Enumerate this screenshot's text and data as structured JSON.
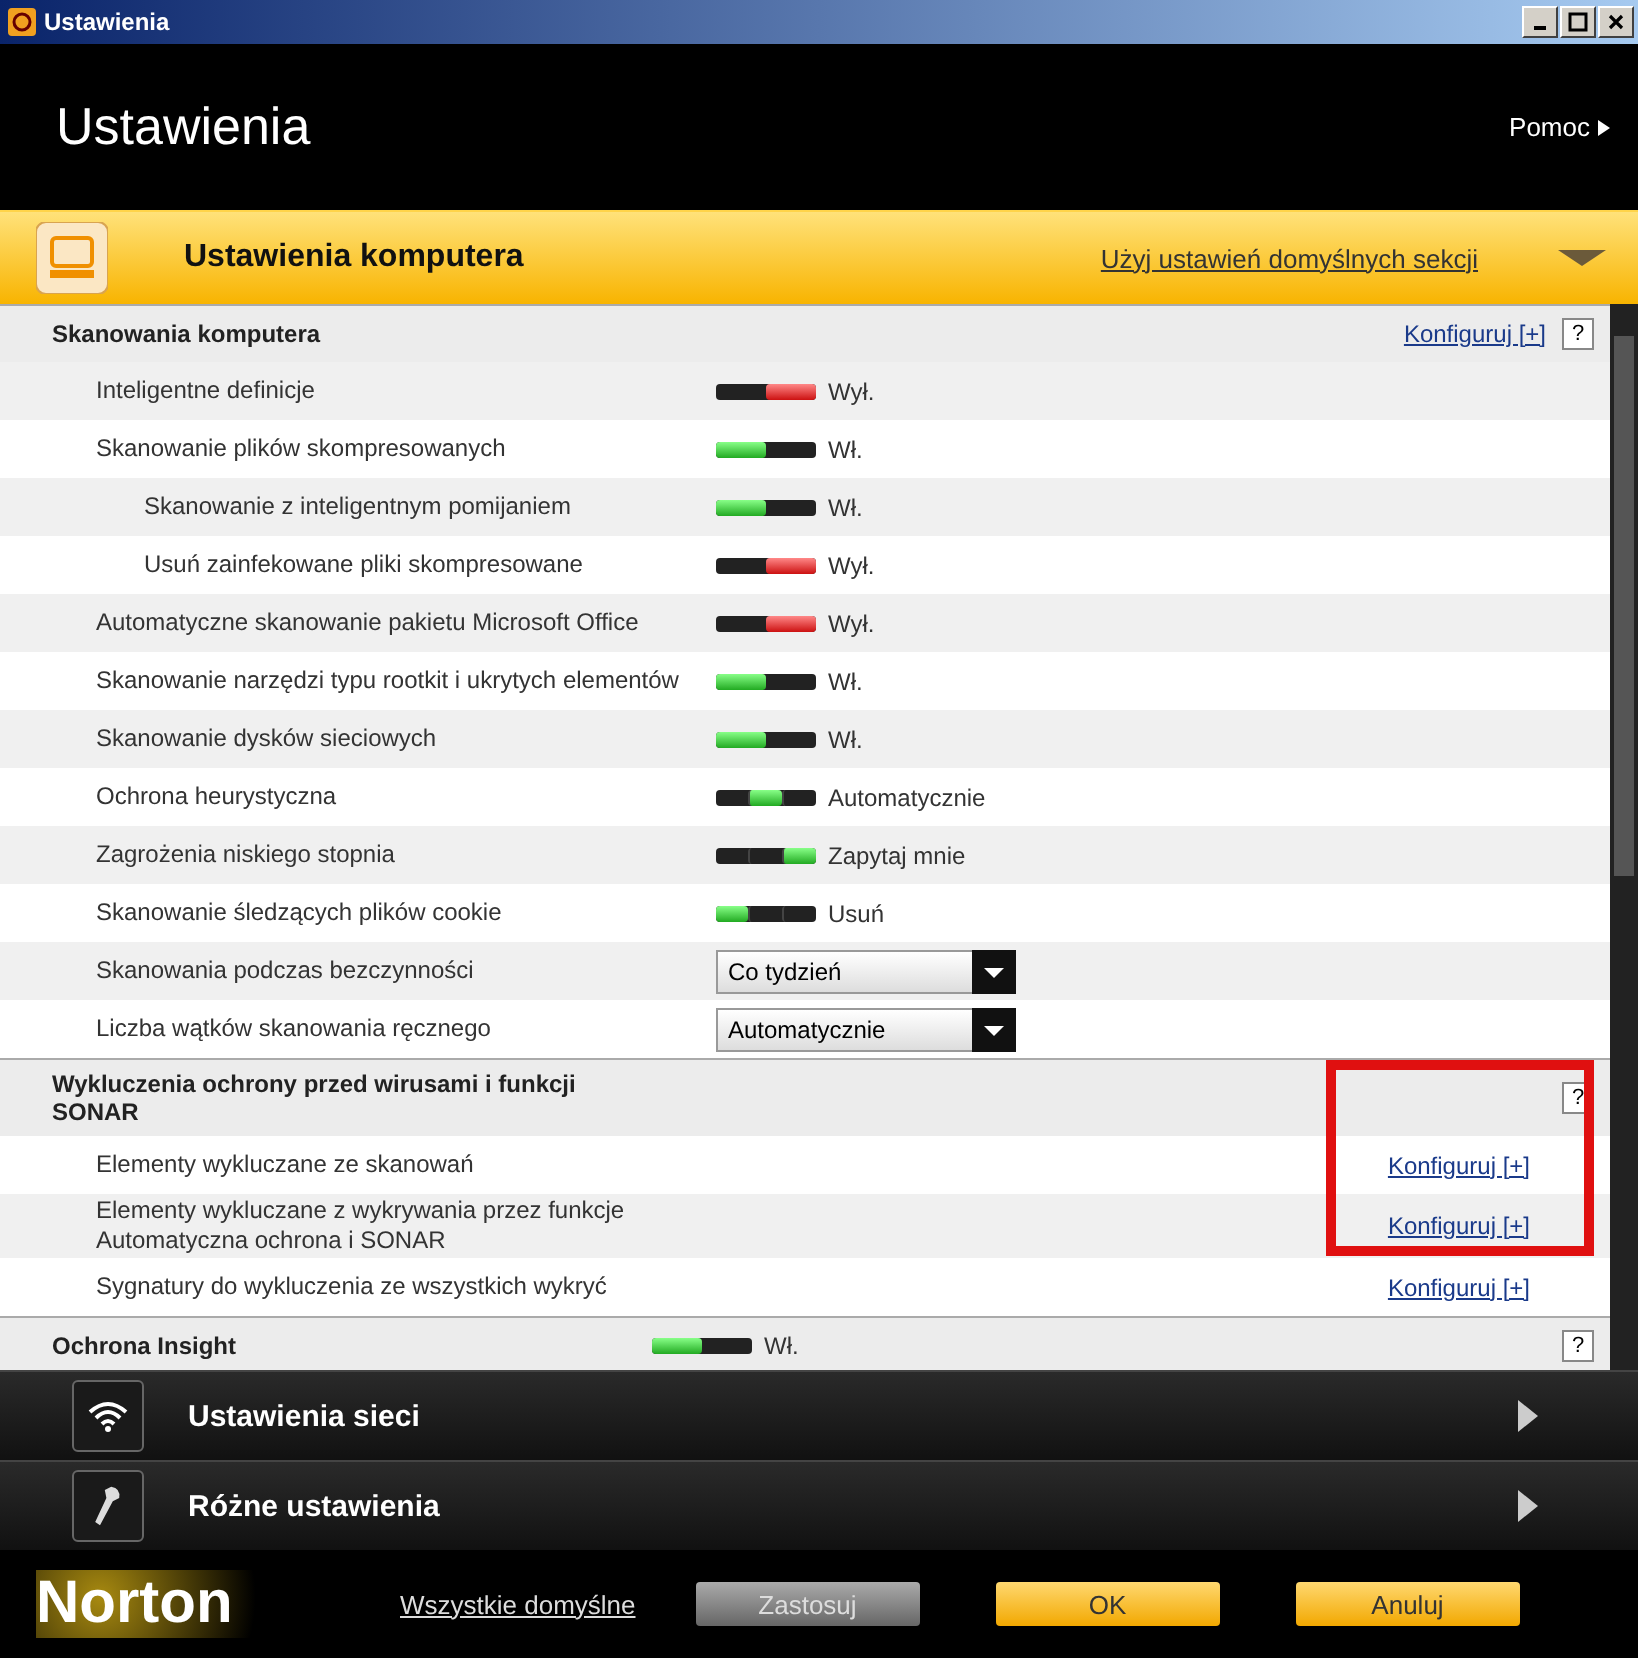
{
  "window": {
    "title": "Ustawienia"
  },
  "header": {
    "title": "Ustawienia",
    "help": "Pomoc"
  },
  "category": {
    "title": "Ustawienia komputera",
    "defaults_link": "Użyj ustawień domyślnych sekcji",
    "expanded": true
  },
  "sections": [
    {
      "title": "Skanowania komputera",
      "link": "Konfiguruj [+]",
      "help": "?",
      "rows": [
        {
          "kind": "switch",
          "label": "Inteligentne definicje",
          "on": false,
          "value": "Wył."
        },
        {
          "kind": "switch",
          "label": "Skanowanie plików skompresowanych",
          "on": true,
          "value": "Wł.",
          "children": [
            {
              "kind": "switch",
              "label": "Skanowanie z inteligentnym pomijaniem",
              "on": true,
              "value": "Wł."
            },
            {
              "kind": "switch",
              "label": "Usuń zainfekowane pliki skompresowane",
              "on": false,
              "value": "Wył."
            }
          ]
        },
        {
          "kind": "switch",
          "label": "Automatyczne skanowanie pakietu Microsoft Office",
          "on": false,
          "value": "Wył."
        },
        {
          "kind": "switch",
          "label": "Skanowanie narzędzi typu rootkit i ukrytych elementów",
          "on": true,
          "value": "Wł."
        },
        {
          "kind": "switch",
          "label": "Skanowanie dysków sieciowych",
          "on": true,
          "value": "Wł."
        },
        {
          "kind": "slider",
          "label": "Ochrona heurystyczna",
          "stops": [
            {
              "selected": false
            },
            {
              "selected": true
            },
            {
              "selected": false
            }
          ],
          "value": "Automatycznie"
        },
        {
          "kind": "slider",
          "label": "Zagrożenia niskiego stopnia",
          "stops": [
            {
              "selected": false
            },
            {
              "selected": false
            },
            {
              "selected": true
            }
          ],
          "value": "Zapytaj mnie"
        },
        {
          "kind": "slider",
          "label": "Skanowanie śledzących plików cookie",
          "stops": [
            {
              "selected": true
            },
            {
              "selected": false
            },
            {
              "selected": false
            }
          ],
          "value": "Usuń"
        },
        {
          "kind": "dropdown",
          "label": "Skanowania podczas bezczynności",
          "value": "Co tydzień"
        },
        {
          "kind": "dropdown",
          "label": "Liczba wątków skanowania ręcznego",
          "value": "Automatycznie"
        }
      ]
    },
    {
      "title": "Wykluczenia ochrony przed wirusami i funkcji SONAR",
      "help": "?",
      "rows": [
        {
          "kind": "link",
          "label": "Elementy wykluczane ze skanowań",
          "value": "Konfiguruj [+]"
        },
        {
          "kind": "link",
          "label": "Elementy wykluczane z wykrywania przez funkcje Automatyczna ochrona i SONAR",
          "value": "Konfiguruj [+]"
        },
        {
          "kind": "link",
          "label": "Sygnatury do wykluczenia ze wszystkich wykryć",
          "value": "Konfiguruj [+]"
        }
      ]
    },
    {
      "title": "Ochrona Insight",
      "help": "?",
      "on": true,
      "value": "Wł."
    }
  ],
  "groups": [
    {
      "kind": "network",
      "title": "Ustawienia sieci",
      "expanded": false
    },
    {
      "kind": "misc",
      "title": "Różne ustawienia",
      "expanded": false
    }
  ],
  "footer": {
    "logo": "Norton",
    "defaults": "Wszystkie domyślne",
    "buttons": [
      {
        "label": "Zastosuj",
        "disabled": true
      },
      {
        "label": "OK",
        "disabled": false
      },
      {
        "label": "Anuluj",
        "disabled": false
      }
    ]
  }
}
